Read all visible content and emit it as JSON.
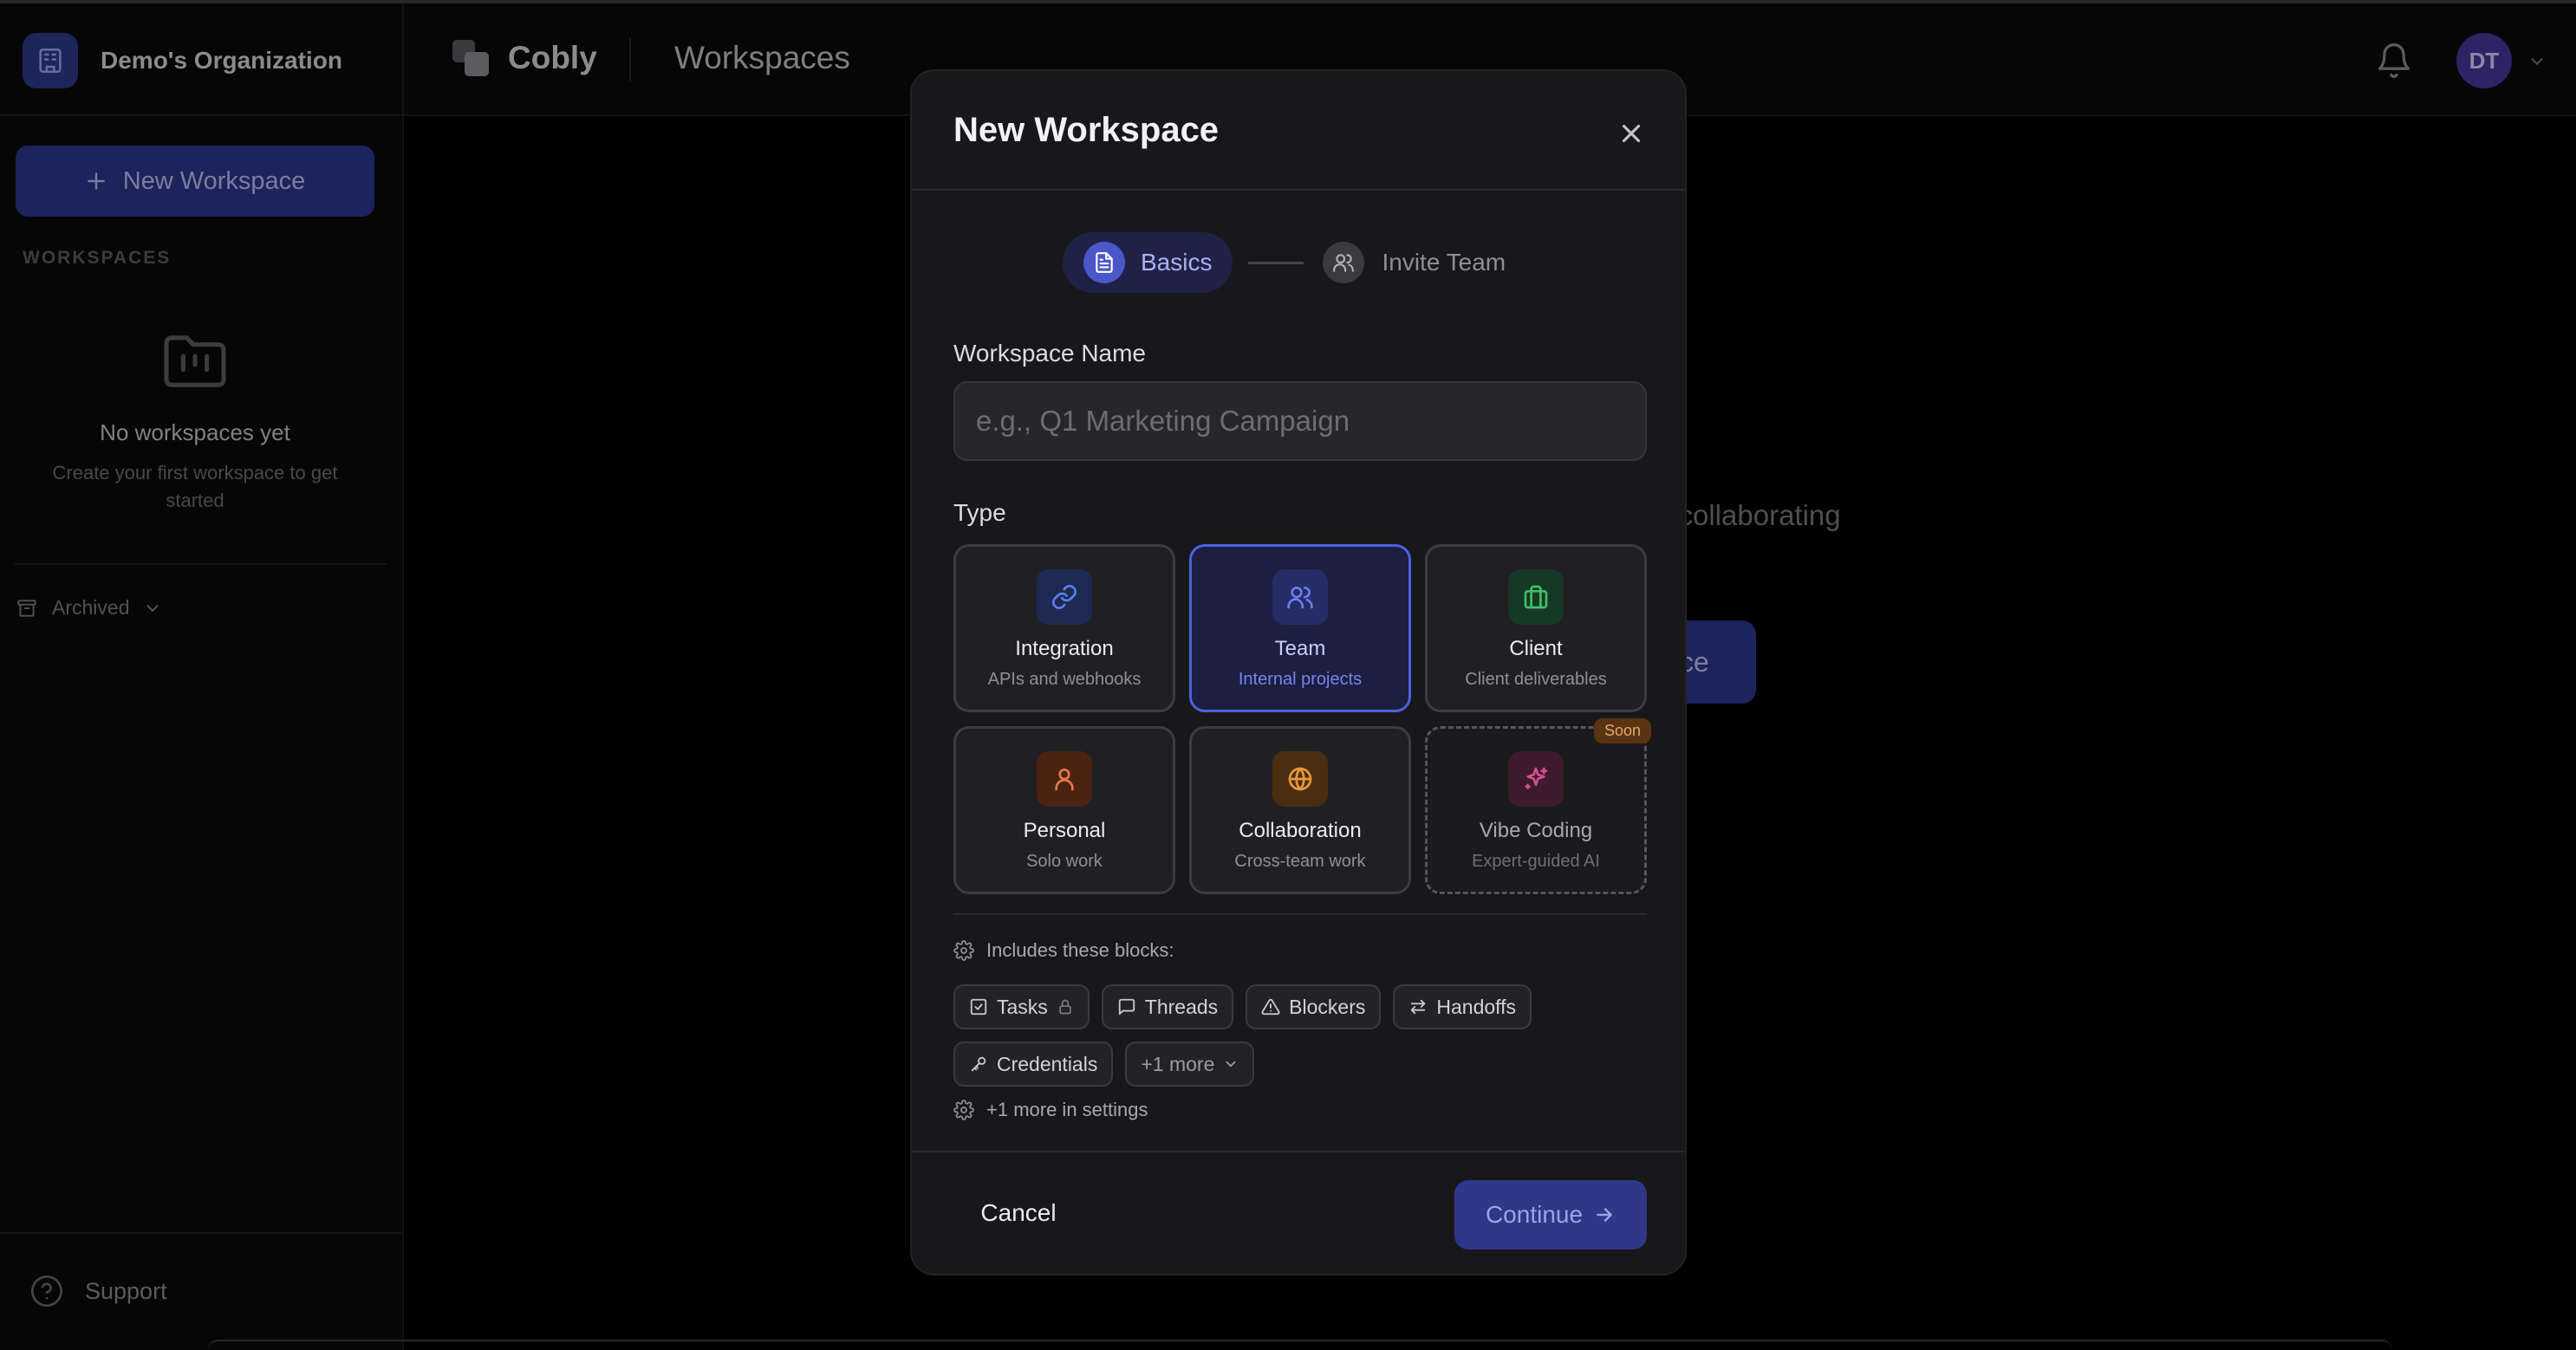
{
  "sidebar": {
    "org_name": "Demo's Organization",
    "new_workspace_label": "New Workspace",
    "section_label": "WORKSPACES",
    "empty_title": "No workspaces yet",
    "empty_subtitle": "Create your first workspace to get started",
    "archived_label": "Archived",
    "support_label": "Support"
  },
  "header": {
    "app_name": "Cobly",
    "page_title": "Workspaces",
    "avatar_initials": "DT"
  },
  "background": {
    "partial_text": "l collaborating",
    "partial_button": "ce"
  },
  "modal": {
    "title": "New Workspace",
    "steps": [
      {
        "label": "Basics",
        "active": true
      },
      {
        "label": "Invite Team",
        "active": false
      }
    ],
    "name_label": "Workspace Name",
    "name_placeholder": "e.g., Q1 Marketing Campaign",
    "name_value": "",
    "type_label": "Type",
    "types": [
      {
        "name": "Integration",
        "desc": "APIs and webhooks",
        "icon": "link-icon",
        "color": "#5b7cf0",
        "bg": "#1e2a52"
      },
      {
        "name": "Team",
        "desc": "Internal projects",
        "icon": "users-icon",
        "color": "#6a7cf0",
        "bg": "#262d66",
        "selected": true
      },
      {
        "name": "Client",
        "desc": "Client deliverables",
        "icon": "briefcase-icon",
        "color": "#3fbf6a",
        "bg": "#163824"
      },
      {
        "name": "Personal",
        "desc": "Solo work",
        "icon": "user-icon",
        "color": "#e8774a",
        "bg": "#4a2312"
      },
      {
        "name": "Collaboration",
        "desc": "Cross-team work",
        "icon": "globe-icon",
        "color": "#e89a3a",
        "bg": "#4a2e10"
      },
      {
        "name": "Vibe Coding",
        "desc": "Expert-guided AI",
        "icon": "sparkles-icon",
        "color": "#d54f8f",
        "bg": "#3e1a2e",
        "badge": "Soon"
      }
    ],
    "blocks_heading": "Includes these blocks:",
    "blocks": [
      {
        "label": "Tasks",
        "icon": "checkbox-icon",
        "locked": true
      },
      {
        "label": "Threads",
        "icon": "message-icon"
      },
      {
        "label": "Blockers",
        "icon": "alert-triangle-icon"
      },
      {
        "label": "Handoffs",
        "icon": "arrows-swap-icon"
      },
      {
        "label": "Credentials",
        "icon": "key-icon"
      }
    ],
    "more_label": "+1 more",
    "more_settings": "+1 more in settings",
    "cancel_label": "Cancel",
    "continue_label": "Continue"
  },
  "colors": {
    "accent": "#4f60e0",
    "primary_button": "#2f3789",
    "modal_bg": "#18181b",
    "page_bg": "#000000"
  }
}
